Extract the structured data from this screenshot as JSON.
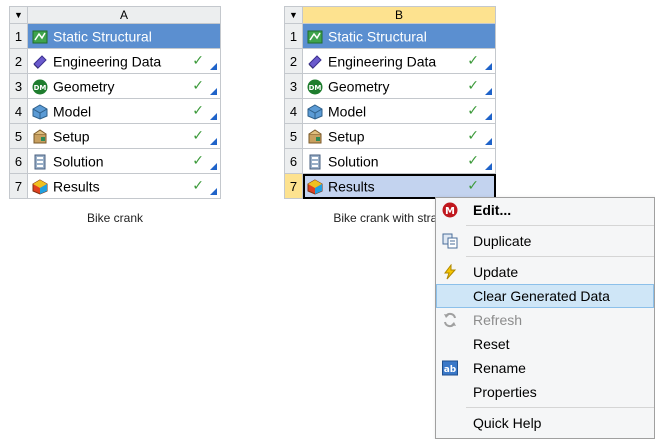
{
  "systems": [
    {
      "column": "A",
      "caption": "Bike crank",
      "rows": [
        {
          "num": "1",
          "label": "Static Structural",
          "icon": "static-structural-icon"
        },
        {
          "num": "2",
          "label": "Engineering Data",
          "icon": "engineering-data-icon"
        },
        {
          "num": "3",
          "label": "Geometry",
          "icon": "geometry-icon"
        },
        {
          "num": "4",
          "label": "Model",
          "icon": "model-icon"
        },
        {
          "num": "5",
          "label": "Setup",
          "icon": "setup-icon"
        },
        {
          "num": "6",
          "label": "Solution",
          "icon": "solution-icon"
        },
        {
          "num": "7",
          "label": "Results",
          "icon": "results-icon"
        }
      ]
    },
    {
      "column": "B",
      "caption": "Bike crank with strain",
      "rows": [
        {
          "num": "1",
          "label": "Static Structural",
          "icon": "static-structural-icon"
        },
        {
          "num": "2",
          "label": "Engineering Data",
          "icon": "engineering-data-icon"
        },
        {
          "num": "3",
          "label": "Geometry",
          "icon": "geometry-icon"
        },
        {
          "num": "4",
          "label": "Model",
          "icon": "model-icon"
        },
        {
          "num": "5",
          "label": "Setup",
          "icon": "setup-icon"
        },
        {
          "num": "6",
          "label": "Solution",
          "icon": "solution-icon"
        },
        {
          "num": "7",
          "label": "Results",
          "icon": "results-icon"
        }
      ]
    }
  ],
  "context_menu": {
    "items": [
      "Edit...",
      "Duplicate",
      "Update",
      "Clear Generated Data",
      "Refresh",
      "Reset",
      "Rename",
      "Properties",
      "Quick Help"
    ]
  },
  "colors": {
    "title_bg": "#5b8fd0",
    "header_b_bg": "#fde28f",
    "check": "#3c9a3a",
    "corner": "#1f63c9",
    "hover": "#cfe6f7"
  }
}
